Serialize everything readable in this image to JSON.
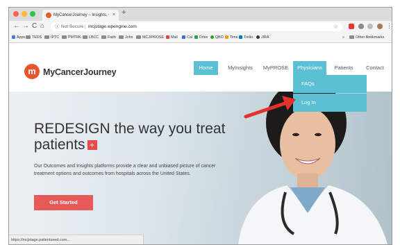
{
  "browser": {
    "tab_title": "MyCancerJourney – Insights, O",
    "tab_close": "×",
    "new_tab": "+",
    "nav": {
      "back": "←",
      "forward": "→",
      "reload": "C",
      "home": "⌂"
    },
    "omnibox": {
      "info_icon": "ⓘ",
      "security": "Not Secure",
      "separator": "|",
      "url": "mcjstage.wpengine.com",
      "star": "☆"
    },
    "menu": "⋮"
  },
  "bookmarks": {
    "apps": "Apps",
    "items": [
      "TEDS",
      "IPTC",
      "PMTRK",
      "LBCC",
      "Faith",
      "John",
      "MCJ/PROSE",
      "Mail",
      "Cal",
      "Drive",
      "QBO",
      "Time",
      "Trello",
      "JIRA"
    ],
    "overflow": "»",
    "other": "Other Bookmarks"
  },
  "site": {
    "logo_text": "MyCancerJourney",
    "logo_mark": "m",
    "nav": [
      "Home",
      "MyInsights",
      "MyPROSE",
      "Physicians",
      "Patients",
      "Contact"
    ],
    "dropdown": [
      "FAQs",
      "Log In"
    ],
    "hero": {
      "headline": "REDESIGN the way you treat patients",
      "plus": "+",
      "body": "Our Outcomes and Insights platforms provide a clear and unbiased picture of cancer treatment options and outcomes from hospitals across the United States.",
      "cta": "Get Started"
    },
    "status_url": "https://mcjstage.patientseed.com..."
  },
  "colors": {
    "accent": "#5bc0d4",
    "cta": "#e85a5a",
    "logo": "#e8542b",
    "arrow": "#e53030"
  }
}
